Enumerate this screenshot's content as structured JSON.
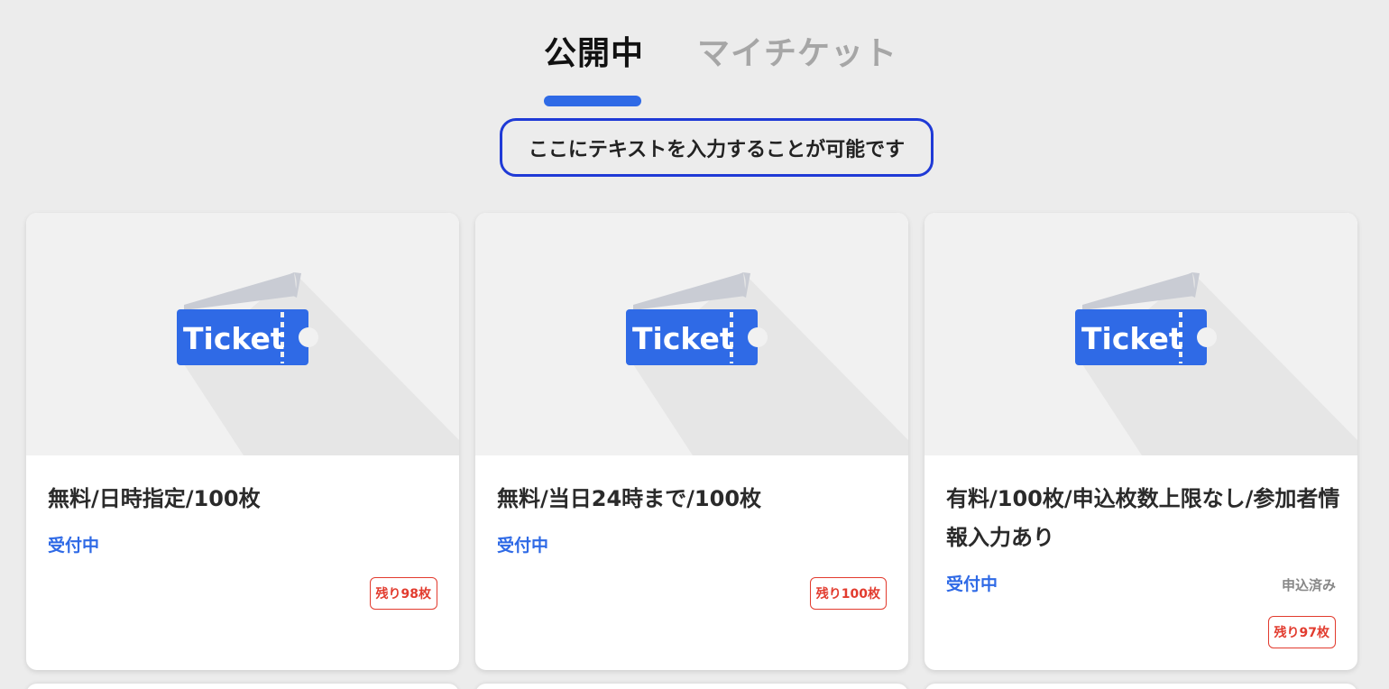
{
  "tabs": [
    {
      "label": "公開中",
      "active": true
    },
    {
      "label": "マイチケット",
      "active": false
    }
  ],
  "notice": {
    "text": "ここにテキストを入力することが可能です"
  },
  "theme": {
    "accent": "#2f6ae6",
    "notice_border": "#1f3ad6",
    "remaining_color": "#e23b2e"
  },
  "tickets": [
    {
      "image_label": "Ticket",
      "title": "無料/日時指定/100枚",
      "status": "受付中",
      "applied": "",
      "remaining": "残り98枚"
    },
    {
      "image_label": "Ticket",
      "title": "無料/当日24時まで/100枚",
      "status": "受付中",
      "applied": "",
      "remaining": "残り100枚"
    },
    {
      "image_label": "Ticket",
      "title": "有料/100枚/申込枚数上限なし/参加者情報入力あり",
      "status": "受付中",
      "applied": "申込済み",
      "remaining": "残り97枚"
    }
  ]
}
